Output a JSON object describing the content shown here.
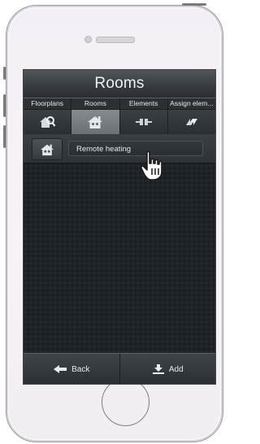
{
  "screen": {
    "title": "Rooms",
    "tabs": [
      {
        "label": "Floorplans",
        "icon": "floorplan-search-icon"
      },
      {
        "label": "Rooms",
        "icon": "house-icon"
      },
      {
        "label": "Elements",
        "icon": "elements-icon"
      },
      {
        "label": "Assign elem...",
        "icon": "assign-arrows-icon"
      }
    ],
    "active_tab": "Rooms",
    "room": {
      "icon": "house-icon",
      "name": "Remote heating"
    },
    "bottom": {
      "back_label": "Back",
      "add_label": "Add"
    }
  },
  "colors": {
    "screen_bg": "#1f2327",
    "title_text": "#eef2f4",
    "active_tab": "#7a8084"
  }
}
